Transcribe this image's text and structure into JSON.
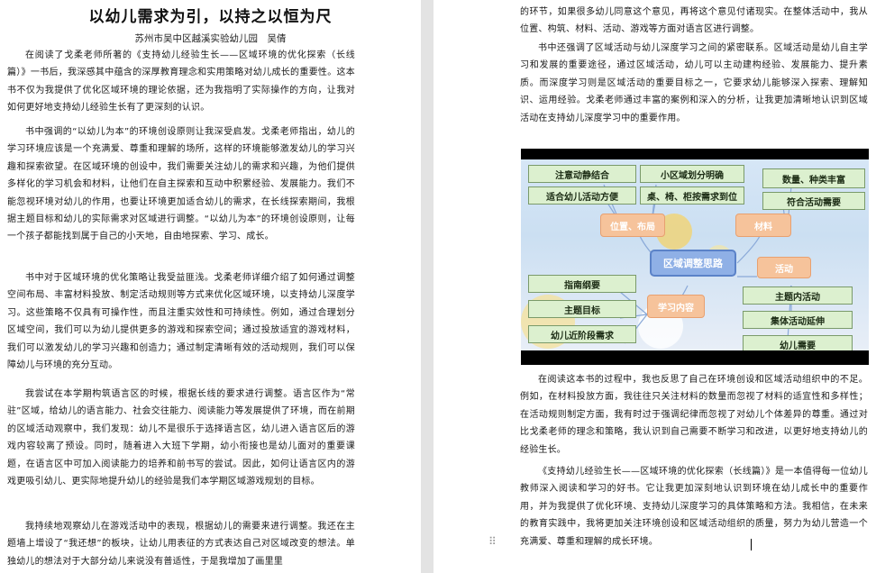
{
  "left_page": {
    "title": "以幼儿需求为引，以持之以恒为尺",
    "author": "苏州市吴中区越溪实验幼儿园　吴倩",
    "paragraphs": [
      "在阅读了戈柔老师所著的《支持幼儿经验生长——区域环境的优化探索（长线篇）》一书后，我深感其中蕴含的深厚教育理念和实用策略对幼儿成长的重要性。这本书不仅为我提供了优化区域环境的理论依据，还为我指明了实际操作的方向，让我对如何更好地支持幼儿经验生长有了更深刻的认识。",
      "书中强调的“以幼儿为本”的环境创设原则让我深受启发。戈柔老师指出，幼儿的学习环境应该是一个充满爱、尊重和理解的场所，这样的环境能够激发幼儿的学习兴趣和探索欲望。在区域环境的创设中，我们需要关注幼儿的需求和兴趣，为他们提供多样化的学习机会和材料，让他们在自主探索和互动中积累经验、发展能力。我们不能忽视环境对幼儿的作用，也要让环境更加适合幼儿的需求，在长线探索期间，我根据主题目标和幼儿的实际需求对区域进行调整。“以幼儿为本”的环境创设原则，让每一个孩子都能找到属于自己的小天地，自由地探索、学习、成长。",
      "书中对于区域环境的优化策略让我受益匪浅。戈柔老师详细介绍了如何通过调整空间布局、丰富材料投放、制定活动规则等方式来优化区域环境，以支持幼儿深度学习。这些策略不仅具有可操作性，而且注重实效性和可持续性。例如，通过合理划分区域空间，我们可以为幼儿提供更多的游戏和探索空间；通过投放适宜的游戏材料，我们可以激发幼儿的学习兴趣和创造力；通过制定清晰有效的活动规则，我们可以保障幼儿与环境的充分互动。",
      "我尝试在本学期构筑语言区的时候，根据长线的要求进行调整。语言区作为“常驻”区域，给幼儿的语言能力、社会交往能力、阅读能力等发展提供了环境，而在前期的区域活动观察中，我们发现：幼儿不是很乐于选择语言区，幼儿进入语言区后的游戏内容较离了预设。同时，随着进入大班下学期，幼小衔接也是幼儿面对的重要课题，在语言区中可加入阅读能力的培养和前书写的尝试。因此，如何让语言区内的游戏更吸引幼儿、更实际地提升幼儿的经验是我们本学期区域游戏规划的目标。",
      "我持续地观察幼儿在游戏活动中的表现，根据幼儿的需要来进行调整。我还在主题墙上增设了“我还想”的板块，让幼儿用表征的方式表达自己对区域改变的想法。单独幼儿的想法对于大部分幼儿来说没有普适性，于是我增加了画里里"
    ]
  },
  "right_page": {
    "paragraphs_top": [
      "的环节，如果很多幼儿同意这个意见，再将这个意见付诸现实。在整体活动中，我从位置、构筑、材料、活动、游戏等方面对语言区进行调整。",
      "书中还强调了区域活动与幼儿深度学习之间的紧密联系。区域活动是幼儿自主学习和发展的重要途径，通过区域活动，幼儿可以主动建构经验、发展能力、提升素质。而深度学习则是区域活动的重要目标之一，它要求幼儿能够深入探索、理解知识、运用经验。戈柔老师通过丰富的案例和深入的分析，让我更加清晰地认识到区域活动在支持幼儿深度学习中的重要作用。"
    ],
    "paragraphs_bottom": [
      "在阅读这本书的过程中，我也反思了自己在环境创设和区域活动组织中的不足。例如，在材料投放方面，我往往只关注材料的数量而忽视了材料的适宜性和多样性；在活动规则制定方面，我有时过于强调纪律而忽视了对幼儿个体差异的尊重。通过对比戈柔老师的理念和策略，我认识到自己需要不断学习和改进，以更好地支持幼儿的经验生长。",
      "《支持幼儿经验生长——区域环境的优化探索（长线篇）》是一本值得每一位幼儿教师深入阅读和学习的好书。它让我更加深刻地认识到环境在幼儿成长中的重要作用，并为我提供了优化环境、支持幼儿深度学习的具体策略和方法。我相信，在未来的教育实践中，我将更加关注环境创设和区域活动组织的质量，努力为幼儿营造一个充满爱、尊重和理解的成长环境。"
    ]
  },
  "diagram": {
    "center": "区域调整思路",
    "branches": {
      "layout": {
        "label": "位置、布局",
        "items": [
          "注意动静结合",
          "小区域划分明确",
          "适合幼儿活动方便",
          "桌、椅、柜按需求到位"
        ]
      },
      "material": {
        "label": "材料",
        "items": [
          "数量、种类丰富",
          "符合活动需要"
        ]
      },
      "activity": {
        "label": "活动",
        "items": [
          "主题内活动",
          "集体活动延伸",
          "幼儿需要"
        ]
      },
      "content": {
        "label": "学习内容",
        "items": [
          "指南纲要",
          "主题目标",
          "幼儿近阶段需求"
        ]
      }
    },
    "colors": {
      "leaf_fill": "#dcf0cf",
      "branch_fill": "#f6c39b",
      "center_fill": "#8fb0e6"
    },
    "toolbar_icons": "image-toolbar-icons"
  }
}
